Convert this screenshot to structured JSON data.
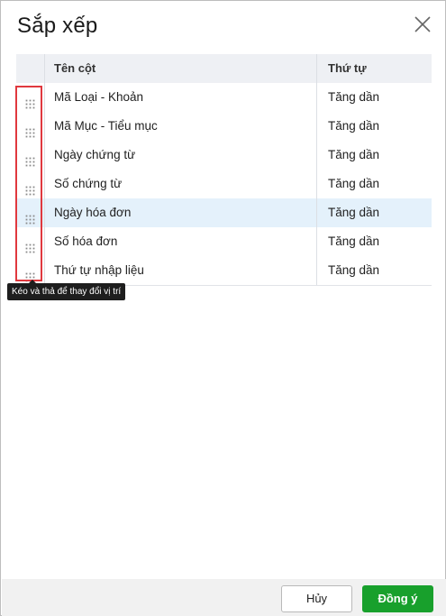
{
  "dialog": {
    "title": "Sắp xếp",
    "close_icon": "close-icon"
  },
  "table": {
    "columns": [
      "",
      "Tên cột",
      "Thứ tự"
    ],
    "rows": [
      {
        "name": "Mã Loại - Khoản",
        "order": "Tăng dần",
        "selected": false
      },
      {
        "name": "Mã Mục - Tiểu mục",
        "order": "Tăng dần",
        "selected": false
      },
      {
        "name": "Ngày chứng từ",
        "order": "Tăng dần",
        "selected": false
      },
      {
        "name": "Số chứng từ",
        "order": "Tăng dần",
        "selected": false
      },
      {
        "name": "Ngày hóa đơn",
        "order": "Tăng dần",
        "selected": true
      },
      {
        "name": "Số hóa đơn",
        "order": "Tăng dần",
        "selected": false
      },
      {
        "name": "Thứ tự nhập liệu",
        "order": "Tăng dần",
        "selected": false
      }
    ],
    "drag_icon": "drag-handle-icon"
  },
  "tooltip": {
    "text": "Kéo và thả để thay đổi vị trí"
  },
  "footer": {
    "cancel_label": "Hủy",
    "ok_label": "Đồng ý"
  },
  "colors": {
    "highlight_border": "#e0383e",
    "selected_row": "#e4f1fb",
    "header_bg": "#eef0f4",
    "ok_button": "#18a02c"
  }
}
